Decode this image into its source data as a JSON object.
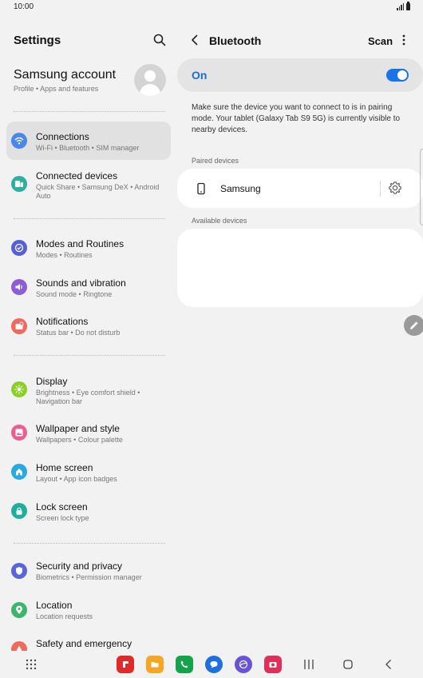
{
  "status_bar": {
    "time": "10:00"
  },
  "left": {
    "title": "Settings",
    "account": {
      "name": "Samsung account",
      "sub": "Profile  •  Apps and features"
    },
    "items": [
      {
        "title": "Connections",
        "sub": "Wi-Fi  •  Bluetooth  •  SIM manager",
        "icon": "wifi-icon",
        "color": "#4a86ec"
      },
      {
        "title": "Connected devices",
        "sub": "Quick Share  •  Samsung DeX  •  Android Auto",
        "icon": "devices-icon",
        "color": "#2bb0a1"
      },
      {
        "title": "Modes and Routines",
        "sub": "Modes  •  Routines",
        "icon": "check-circle-icon",
        "color": "#5560d6"
      },
      {
        "title": "Sounds and vibration",
        "sub": "Sound mode  •  Ringtone",
        "icon": "speaker-icon",
        "color": "#8b5ed8"
      },
      {
        "title": "Notifications",
        "sub": "Status bar  •  Do not disturb",
        "icon": "notification-icon",
        "color": "#ee6b60"
      },
      {
        "title": "Display",
        "sub": "Brightness  •  Eye comfort shield  •  Navigation bar",
        "icon": "sun-icon",
        "color": "#8ccf2a"
      },
      {
        "title": "Wallpaper and style",
        "sub": "Wallpapers  •  Colour palette",
        "icon": "image-icon",
        "color": "#ea5f93"
      },
      {
        "title": "Home screen",
        "sub": "Layout  •  App icon badges",
        "icon": "home-icon",
        "color": "#2aa8e0"
      },
      {
        "title": "Lock screen",
        "sub": "Screen lock type",
        "icon": "lock-icon",
        "color": "#1eb09a"
      },
      {
        "title": "Security and privacy",
        "sub": "Biometrics  •  Permission manager",
        "icon": "shield-icon",
        "color": "#5965d8"
      },
      {
        "title": "Location",
        "sub": "Location requests",
        "icon": "location-icon",
        "color": "#3db56b"
      },
      {
        "title": "Safety and emergency",
        "sub": "",
        "icon": "emergency-icon",
        "color": "#ee6b60"
      }
    ]
  },
  "right": {
    "title": "Bluetooth",
    "scan_label": "Scan",
    "toggle_label": "On",
    "toggle_on": true,
    "description": "Make sure the device you want to connect to is in pairing mode. Your tablet (Galaxy Tab S9 5G) is currently visible to nearby devices.",
    "paired_label": "Paired devices",
    "paired_devices": [
      {
        "name": "Samsung"
      }
    ],
    "available_label": "Available devices"
  },
  "dock": {
    "apps": [
      {
        "icon": "flipboard-icon",
        "color": "#e02a2a"
      },
      {
        "icon": "folder-icon",
        "color": "#f5a623"
      },
      {
        "icon": "phone-icon",
        "color": "#14a34b"
      },
      {
        "icon": "messages-icon",
        "color": "#1f6fe0"
      },
      {
        "icon": "internet-icon",
        "color": "#6a52d8"
      },
      {
        "icon": "camera-icon",
        "color": "#e0305a"
      }
    ]
  }
}
